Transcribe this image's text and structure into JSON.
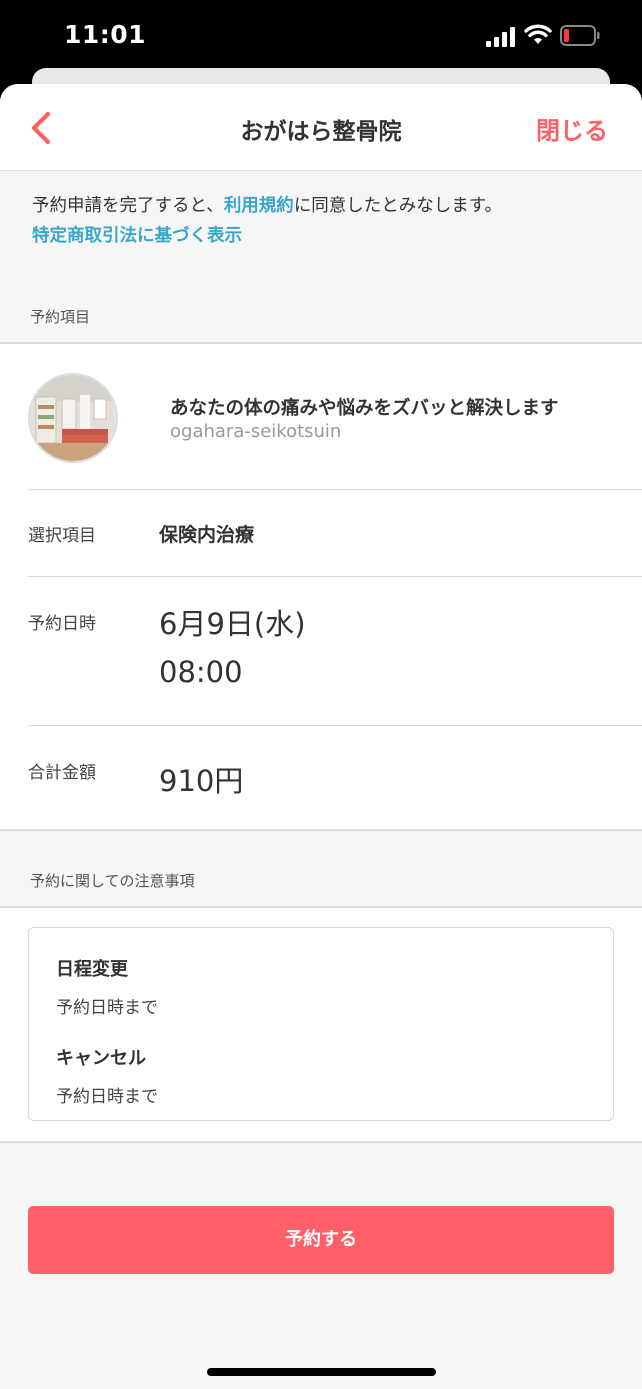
{
  "status_bar": {
    "time": "11:01"
  },
  "header": {
    "title": "おがはら整骨院",
    "close_label": "閉じる"
  },
  "notice": {
    "prefix": "予約申請を完了すると、",
    "terms_link": "利用規約",
    "suffix": "に同意したとみなします。",
    "commerce_link": "特定商取引法に基づく表示"
  },
  "reservation": {
    "section_label": "予約項目",
    "item": {
      "title": "あなたの体の痛みや悩みをズバッと解決します",
      "subtitle": "ogahara-seikotsuin"
    },
    "selection": {
      "label": "選択項目",
      "value": "保険内治療"
    },
    "datetime": {
      "label": "予約日時",
      "date": "6月9日(水)",
      "time": "08:00"
    },
    "total": {
      "label": "合計金額",
      "value": "910円"
    }
  },
  "notes": {
    "section_label": "予約に関しての注意事項",
    "reschedule": {
      "heading": "日程変更",
      "text": "予約日時まで"
    },
    "cancel": {
      "heading": "キャンセル",
      "text": "予約日時まで"
    }
  },
  "cta": {
    "label": "予約する"
  },
  "colors": {
    "accent": "#ff6068",
    "link": "#3aa7c9",
    "background": "#f6f6f6"
  },
  "icons": [
    "back-chevron-icon",
    "signal-icon",
    "wifi-icon",
    "battery-icon"
  ]
}
